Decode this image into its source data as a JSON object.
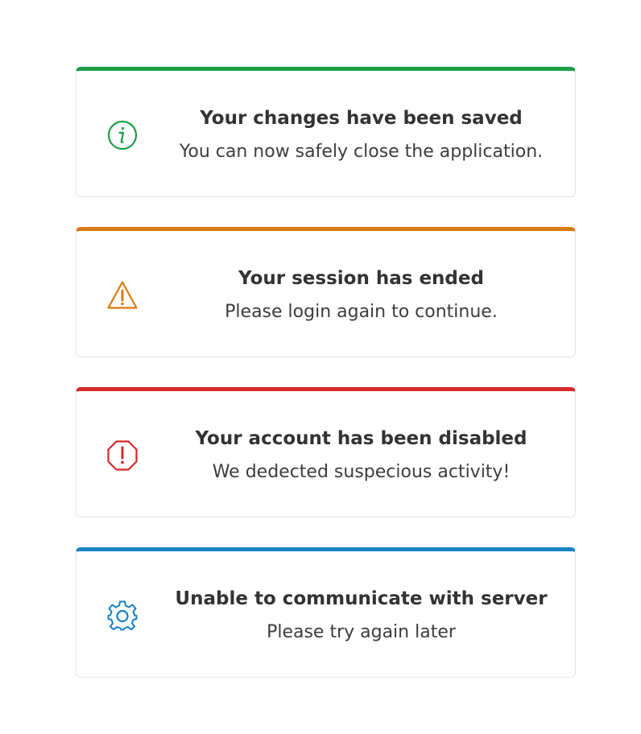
{
  "alerts": [
    {
      "variant": "success",
      "icon": "info-icon",
      "color": "#1e9e48",
      "title": "Your changes have been saved",
      "message": "You can now safely close the application."
    },
    {
      "variant": "warning",
      "icon": "warning-triangle-icon",
      "color": "#db7a12",
      "title": "Your session has ended",
      "message": "Please login again to continue."
    },
    {
      "variant": "error",
      "icon": "stop-octagon-icon",
      "color": "#d42a2a",
      "title": "Your account has been disabled",
      "message": "We dedected suspecious activity!"
    },
    {
      "variant": "info",
      "icon": "gear-icon",
      "color": "#1682c4",
      "title": "Unable to communicate with server",
      "message": "Please try again later"
    }
  ]
}
